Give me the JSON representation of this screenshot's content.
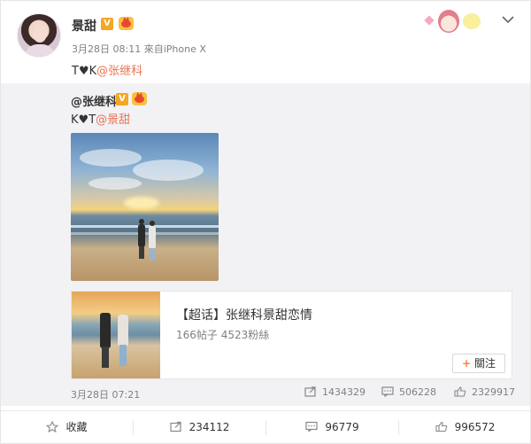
{
  "post": {
    "username": "景甜",
    "verified_badge": "V",
    "date": "3月28日 08:11",
    "source": "來自iPhone X",
    "text_prefix": "T",
    "text_heart": "♥",
    "text_suffix": "K",
    "mention": "@张继科"
  },
  "repost": {
    "username": "@张继科",
    "verified_badge": "V",
    "text_prefix": "K",
    "text_heart": "♥",
    "text_suffix": "T",
    "mention": "@景甜",
    "topic": {
      "title": "【超话】张继科景甜恋情",
      "stats": "166帖子 4523粉絲",
      "follow_label": "關注",
      "follow_plus": "+"
    },
    "date": "3月28日 07:21",
    "reposts": "1434329",
    "comments": "506228",
    "likes": "2329917"
  },
  "actions": {
    "favorite": "收藏",
    "repost": "234112",
    "comment": "96779",
    "like": "996572"
  },
  "colors": {
    "mention": "#eb7350",
    "repost_bg": "#f2f2f5",
    "follow_plus": "#ff8140",
    "badge": "#f5a623"
  }
}
